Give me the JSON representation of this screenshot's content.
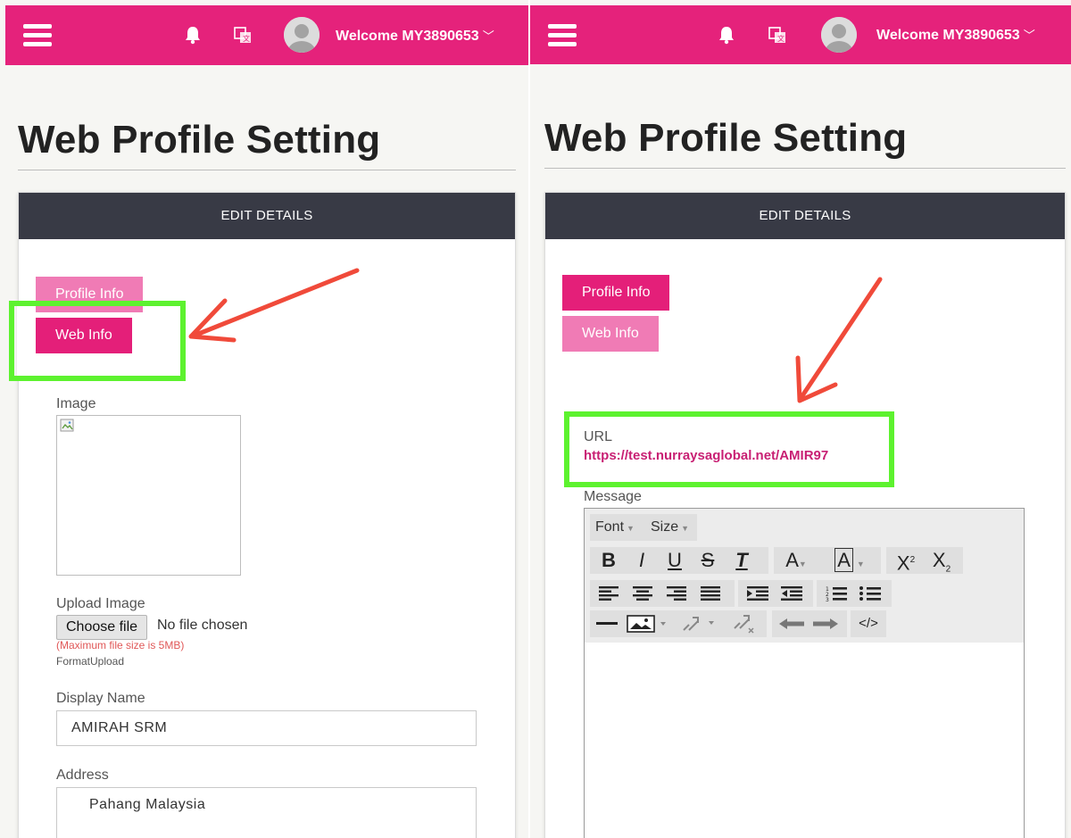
{
  "header": {
    "welcome_text": "Welcome MY3890653",
    "chevron": "﹀",
    "icons": [
      "menu-icon",
      "bell-icon",
      "language-icon",
      "avatar"
    ],
    "brand_color": "#e5227b"
  },
  "page": {
    "title": "Web Profile Setting"
  },
  "card": {
    "header": "EDIT DETAILS"
  },
  "tabs": {
    "profile_info": "Profile Info",
    "web_info": "Web Info"
  },
  "left_form": {
    "image_label": "Image",
    "upload_label": "Upload Image",
    "choose_file": "Choose file",
    "no_file": "No file chosen",
    "max_size_note": "(Maximum file size is 5MB)",
    "format_note": "FormatUpload",
    "display_name_label": "Display Name",
    "display_name_value": "AMIRAH SRM",
    "address_label": "Address",
    "address_value": "Pahang Malaysia"
  },
  "right_form": {
    "url_label": "URL",
    "url_value": "https://test.nurraysaglobal.net/AMIR97",
    "message_label": "Message",
    "editor": {
      "font_combo": "Font",
      "size_combo": "Size",
      "bold": "B",
      "italic": "I",
      "underline": "U",
      "strike": "S",
      "remove_format": "T",
      "text_color": "A",
      "bg_color": "A",
      "superscript": "X",
      "subscript": "X",
      "source": "</>"
    }
  },
  "annotations": {
    "highlight_color": "#5df22f",
    "arrow_color": "#f04a3a"
  }
}
